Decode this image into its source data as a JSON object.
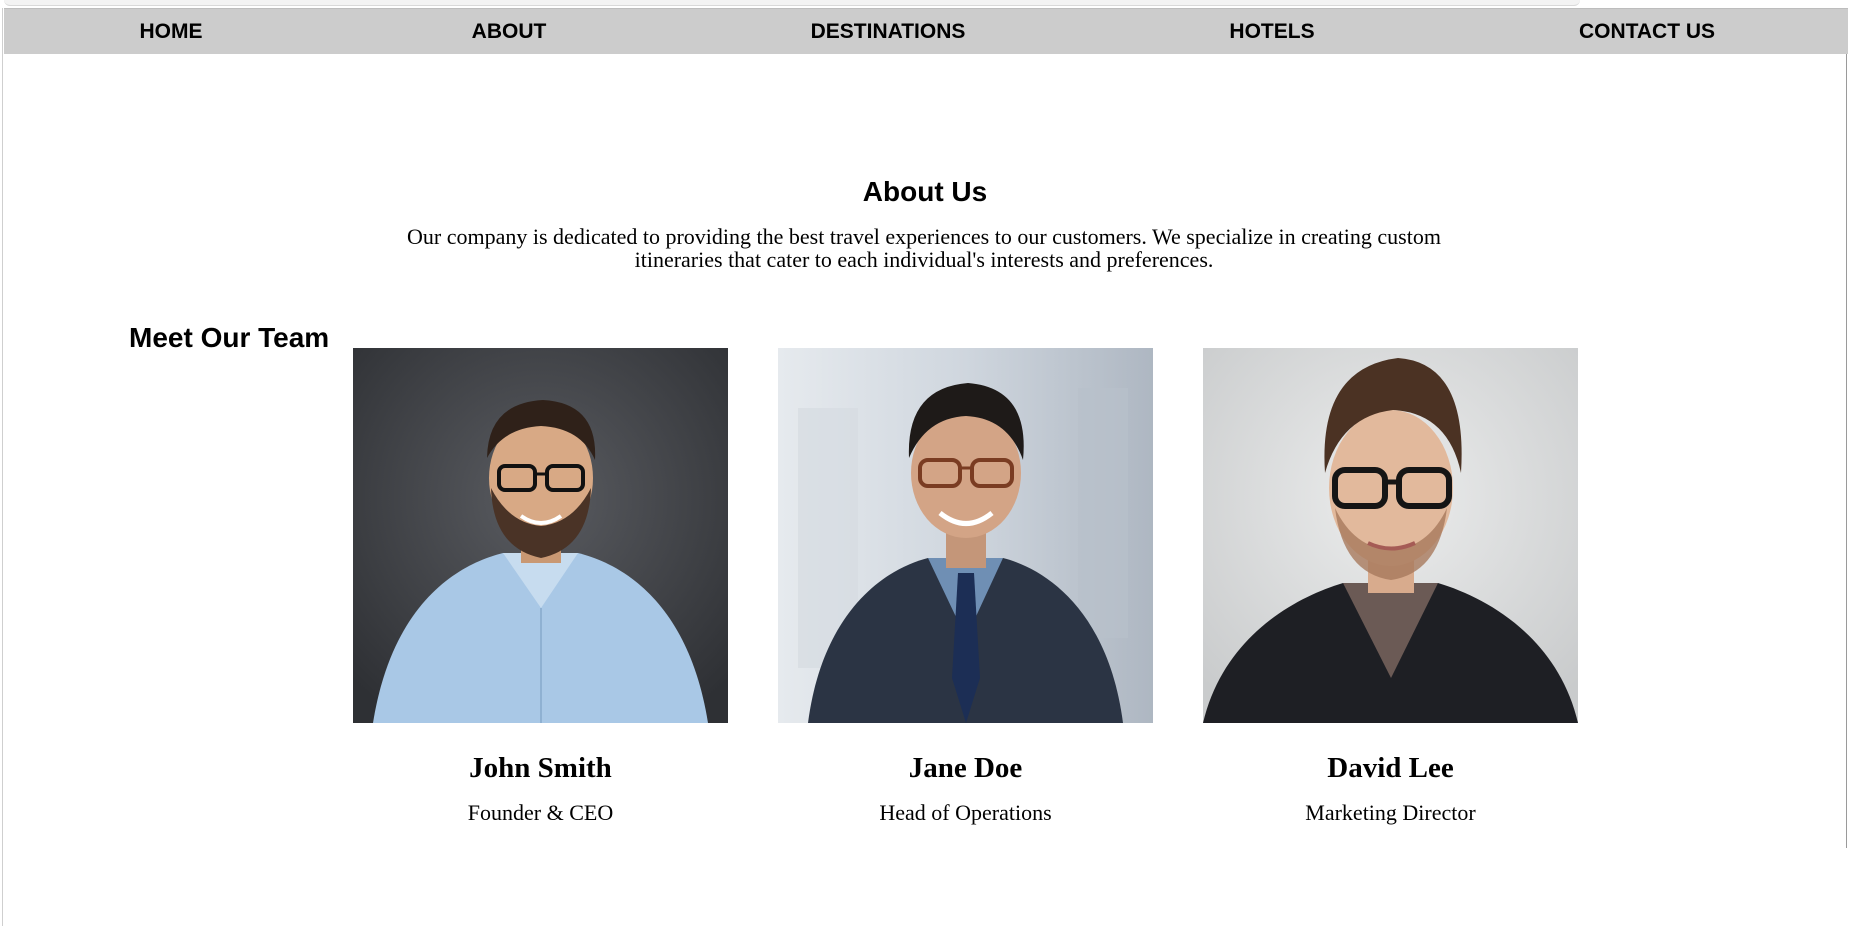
{
  "nav": {
    "items": [
      {
        "label": "HOME"
      },
      {
        "label": "ABOUT"
      },
      {
        "label": "DESTINATIONS"
      },
      {
        "label": "HOTELS"
      },
      {
        "label": "CONTACT US"
      }
    ]
  },
  "about": {
    "title": "About Us",
    "text": "Our company is dedicated to providing the best travel experiences to our customers. We specialize in creating custom itineraries that cater to each individual's interests and preferences."
  },
  "team": {
    "title": "Meet Our Team",
    "members": [
      {
        "name": "John Smith",
        "role": "Founder & CEO"
      },
      {
        "name": "Jane Doe",
        "role": "Head of Operations"
      },
      {
        "name": "David Lee",
        "role": "Marketing Director"
      }
    ]
  }
}
